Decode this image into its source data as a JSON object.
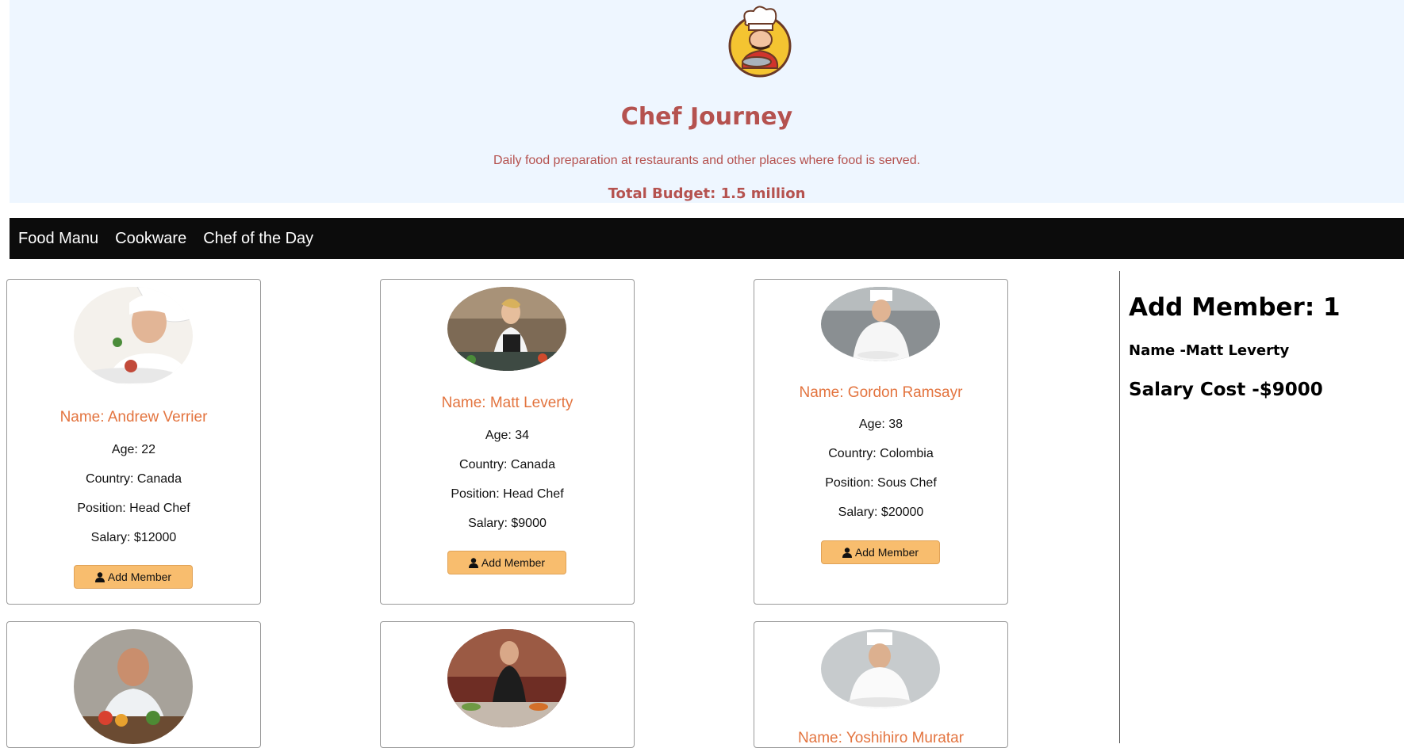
{
  "header": {
    "title": "Chef Journey",
    "description": "Daily food preparation at restaurants and other places where food is served.",
    "budget": "Total Budget: 1.5 million"
  },
  "nav": {
    "items": [
      {
        "label": "Food Manu"
      },
      {
        "label": "Cookware"
      },
      {
        "label": "Chef of the Day"
      }
    ]
  },
  "chefs": [
    {
      "name": "Name: Andrew Verrier",
      "age": "Age: 22",
      "country": "Country: Canada",
      "position": "Position: Head Chef",
      "salary": "Salary: $12000",
      "button": "Add Member"
    },
    {
      "name": "Name: Matt Leverty",
      "age": "Age: 34",
      "country": "Country: Canada",
      "position": "Position: Head Chef",
      "salary": "Salary: $9000",
      "button": "Add Member"
    },
    {
      "name": "Name: Gordon Ramsayr",
      "age": "Age: 38",
      "country": "Country: Colombia",
      "position": "Position: Sous Chef",
      "salary": "Salary: $20000",
      "button": "Add Member"
    },
    {
      "name": "",
      "age": "",
      "country": "",
      "position": "",
      "salary": "",
      "button": ""
    },
    {
      "name": "",
      "age": "",
      "country": "",
      "position": "",
      "salary": "",
      "button": ""
    },
    {
      "name": "Name: Yoshihiro Muratar",
      "age": "",
      "country": "",
      "position": "",
      "salary": "",
      "button": ""
    }
  ],
  "sidebar": {
    "heading": "Add Member: 1",
    "member_name": "Name -Matt Leverty",
    "salary_cost": "Salary Cost -$9000"
  },
  "colors": {
    "header_bg": "#eef6ff",
    "brand_text": "#b5524f",
    "nav_bg": "#0c0c0c",
    "chef_name": "#e3743f",
    "button_bg": "#f8bd6e"
  },
  "icons": {
    "logo": "chef-logo",
    "button": "user-icon"
  }
}
